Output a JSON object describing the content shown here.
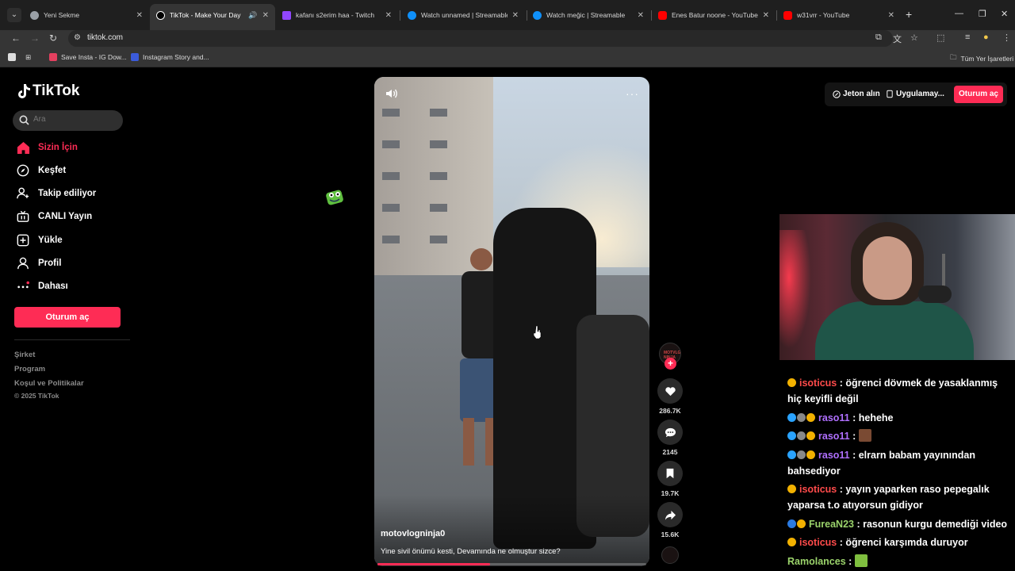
{
  "browser": {
    "tabs": [
      {
        "title": "Yeni Sekme",
        "fav_color": "#9aa0a6"
      },
      {
        "title": "TikTok - Make Your Day",
        "fav_color": "#ffffff",
        "active": true
      },
      {
        "title": "kafanı s2erim haa - Twitch",
        "fav_color": "#9146ff"
      },
      {
        "title": "Watch unnamed | Streamable",
        "fav_color": "#0f90fa"
      },
      {
        "title": "Watch meğic | Streamable",
        "fav_color": "#0f90fa"
      },
      {
        "title": "Enes Batur noone - YouTube",
        "fav_color": "#ff0000"
      },
      {
        "title": "w31vrr - YouTube",
        "fav_color": "#ff0000"
      }
    ],
    "url": "tiktok.com",
    "bookmarks": [
      {
        "label": "Save Insta - IG Dow...",
        "fav_color": "#e4405f"
      },
      {
        "label": "Instagram Story and...",
        "fav_color": "#3b5bdb"
      }
    ],
    "all_bookmarks_label": "Tüm Yer İşaretleri"
  },
  "sidebar": {
    "logo_text": "TikTok",
    "search_placeholder": "Ara",
    "items": [
      {
        "label": "Sizin İçin",
        "icon": "home-icon",
        "active": true
      },
      {
        "label": "Keşfet",
        "icon": "compass-icon"
      },
      {
        "label": "Takip ediliyor",
        "icon": "following-icon"
      },
      {
        "label": "CANLI Yayın",
        "icon": "live-icon"
      },
      {
        "label": "Yükle",
        "icon": "upload-icon"
      },
      {
        "label": "Profil",
        "icon": "profile-icon"
      },
      {
        "label": "Dahası",
        "icon": "more-dots-icon"
      }
    ],
    "login_label": "Oturum aç",
    "footer_links": [
      "Şirket",
      "Program",
      "Koşul ve Politikalar"
    ],
    "copyright": "© 2025 TikTok"
  },
  "video": {
    "author": "motovlogninja0",
    "caption": "Yine sivil önümü kesti, Devamında ne olmuştur sizce?",
    "progress": 0.42,
    "avatar_text": "MOTVLG NINJA",
    "actions": {
      "likes": "286.7K",
      "comments": "2145",
      "saves": "19.7K",
      "shares": "15.6K"
    }
  },
  "topbar": {
    "coins_label": "Jeton alın",
    "app_label": "Uygulamay...",
    "login_label": "Oturum aç"
  },
  "chat": {
    "lines": [
      {
        "user": "isoticus",
        "user_color": "#ff4b4b",
        "badges": [
          "#f2b100"
        ],
        "text": "öğrenci dövmek de yasaklanmış"
      },
      {
        "user": "",
        "user_color": "#ffffff",
        "badges": [],
        "text": "hiç keyifli değil"
      },
      {
        "user": "raso11",
        "user_color": "#b070ff",
        "badges": [
          "#2aa3ff",
          "#888888",
          "#f2b100"
        ],
        "text": "hehehe"
      },
      {
        "user": "raso11",
        "user_color": "#b070ff",
        "badges": [
          "#2aa3ff",
          "#888888",
          "#f2b100"
        ],
        "text": "",
        "emote": "#7a4a33"
      },
      {
        "user": "raso11",
        "user_color": "#b070ff",
        "badges": [
          "#2aa3ff",
          "#888888",
          "#f2b100"
        ],
        "text": "elrarn babam yayınından"
      },
      {
        "user": "",
        "user_color": "#ffffff",
        "badges": [],
        "text": "bahsediyor"
      },
      {
        "user": "isoticus",
        "user_color": "#ff4b4b",
        "badges": [
          "#f2b100"
        ],
        "text": "yayın yaparken raso pepegalık"
      },
      {
        "user": "",
        "user_color": "#ffffff",
        "badges": [],
        "text": "yaparsa t.o atıyorsun gidiyor"
      },
      {
        "user": "FureaN23",
        "user_color": "#9bd36b",
        "badges": [
          "#2a7ae2",
          "#f2b100"
        ],
        "text": "rasonun kurgu demediği video"
      },
      {
        "user": "isoticus",
        "user_color": "#ff4b4b",
        "badges": [
          "#f2b100"
        ],
        "text": "öğrenci karşımda duruyor"
      },
      {
        "user": "Ramolances",
        "user_color": "#9bd36b",
        "badges": [],
        "text": "",
        "emote": "#7fbf3f"
      }
    ]
  },
  "colors": {
    "accent": "#fe2c55"
  }
}
